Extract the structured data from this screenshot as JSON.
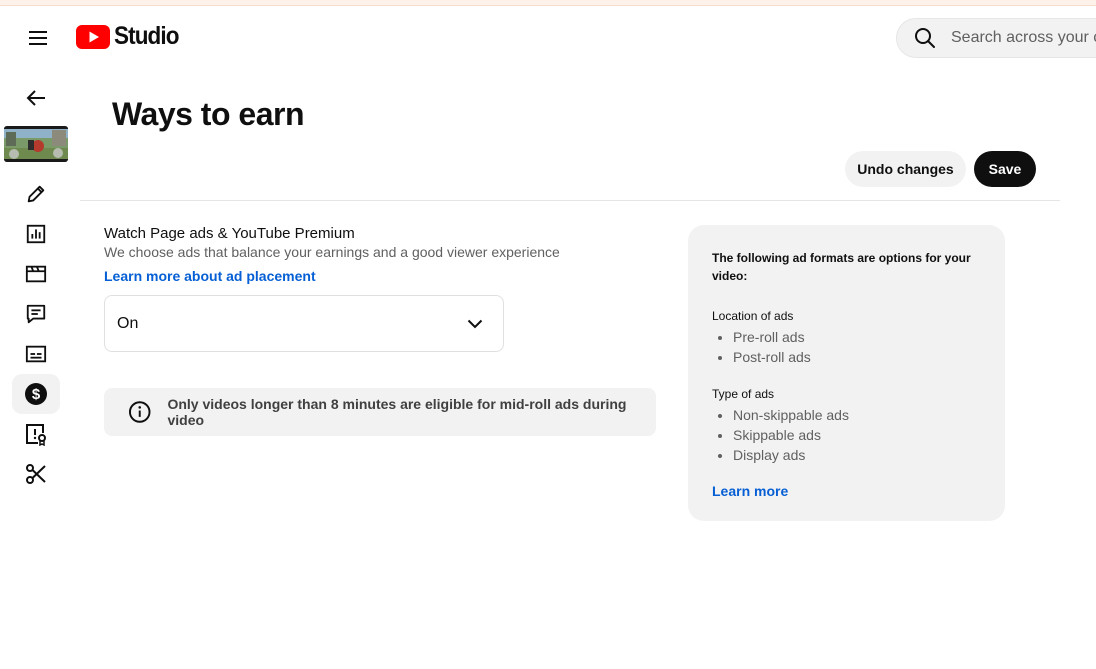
{
  "header": {
    "logo_text": "Studio",
    "search_placeholder": "Search across your channel"
  },
  "page": {
    "title": "Ways to earn",
    "undo_label": "Undo changes",
    "save_label": "Save"
  },
  "section": {
    "title": "Watch Page ads & YouTube Premium",
    "description": "We choose ads that balance your earnings and a good viewer experience",
    "link": "Learn more about ad placement",
    "select_value": "On",
    "notice": "Only videos longer than 8 minutes are eligible for mid-roll ads during video"
  },
  "info_panel": {
    "intro": "The following ad formats are options for your video:",
    "location_title": "Location of ads",
    "location_items": [
      "Pre-roll ads",
      "Post-roll ads"
    ],
    "type_title": "Type of ads",
    "type_items": [
      "Non-skippable ads",
      "Skippable ads",
      "Display ads"
    ],
    "link": "Learn more"
  },
  "colors": {
    "brand_red": "#ff0000",
    "link_blue": "#065fd4",
    "panel_gray": "#f2f2f2"
  },
  "rail_icons": [
    "back-arrow-icon",
    "pencil-icon",
    "analytics-icon",
    "clapperboard-icon",
    "comments-icon",
    "subtitles-icon",
    "monetization-icon",
    "copyright-icon",
    "scissors-icon"
  ]
}
